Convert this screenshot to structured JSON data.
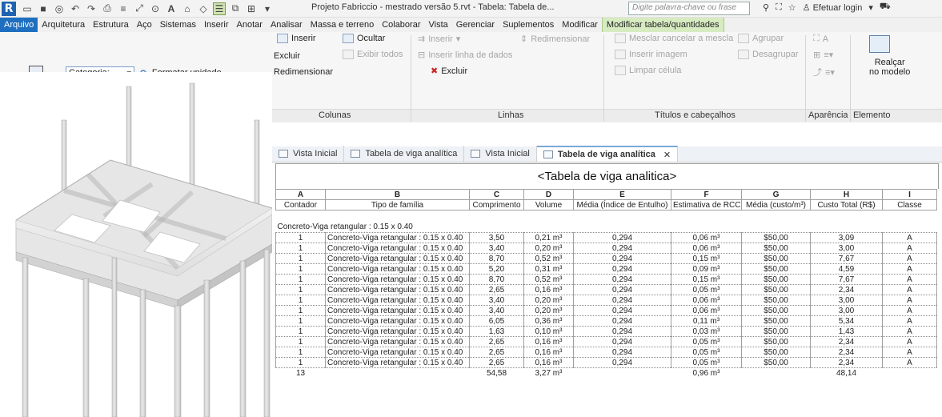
{
  "titlebar": {
    "title": "Projeto Fabriccio - mestrado versão 5.rvt - Tabela: Tabela de...",
    "search_placeholder": "Digite palavra-chave ou frase",
    "login": "Efetuar login"
  },
  "menu": [
    "Arquivo",
    "Arquitetura",
    "Estrutura",
    "Aço",
    "Sistemas",
    "Inserir",
    "Anotar",
    "Analisar",
    "Massa e terreno",
    "Colaborar",
    "Vista",
    "Gerenciar",
    "Suplementos",
    "Modificar",
    "Modificar tabela/quantidades"
  ],
  "props": {
    "category_label": "Categoria:",
    "format_unit": "Formatar unidade"
  },
  "ribbon": {
    "colunas": {
      "inserir": "Inserir",
      "excluir": "Excluir",
      "redimensionar": "Redimensionar",
      "ocultar": "Ocultar",
      "exibir_todos": "Exibir todos",
      "label": "Colunas"
    },
    "linhas": {
      "inserir": "Inserir",
      "inserir_linha": "Inserir linha de dados",
      "excluir": "Excluir",
      "redimensionar": "Redimensionar",
      "label": "Linhas"
    },
    "titulos": {
      "mesclar": "Mesclar cancelar a mescla",
      "agrupar": "Agrupar",
      "inserir_imagem": "Inserir imagem",
      "desagrupar": "Desagrupar",
      "limpar": "Limpar célula",
      "label": "Títulos e cabeçalhos"
    },
    "aparencia": {
      "label": "Aparência"
    },
    "elemento": {
      "realcar": "Realçar",
      "no_modelo": "no modelo",
      "label": "Elemento"
    }
  },
  "tabs": [
    {
      "label": "Vista Inicial",
      "active": false
    },
    {
      "label": "Tabela de viga analítica",
      "active": false
    },
    {
      "label": "Vista Inicial",
      "active": false
    },
    {
      "label": "Tabela de viga analítica",
      "active": true
    }
  ],
  "schedule": {
    "title": "<Tabela de viga analitica>",
    "letters": [
      "A",
      "B",
      "C",
      "D",
      "E",
      "F",
      "G",
      "H",
      "I"
    ],
    "headers": [
      "Contador",
      "Tipo de família",
      "Comprimento",
      "Volume",
      "Média (Índice de Entulho)",
      "Estimativa de RCC",
      "Média (custo/m³)",
      "Custo Total (R$)",
      "Classe"
    ],
    "group_label": "Concreto-Viga retangular : 0.15 x 0.40",
    "rows": [
      [
        "1",
        "Concreto-Viga retangular : 0.15 x 0.40",
        "3,50",
        "0,21 m³",
        "0,294",
        "0,06 m³",
        "$50,00",
        "3,09",
        "A"
      ],
      [
        "1",
        "Concreto-Viga retangular : 0.15 x 0.40",
        "3,40",
        "0,20 m³",
        "0,294",
        "0,06 m³",
        "$50,00",
        "3,00",
        "A"
      ],
      [
        "1",
        "Concreto-Viga retangular : 0.15 x 0.40",
        "8,70",
        "0,52 m³",
        "0,294",
        "0,15 m³",
        "$50,00",
        "7,67",
        "A"
      ],
      [
        "1",
        "Concreto-Viga retangular : 0.15 x 0.40",
        "5,20",
        "0,31 m³",
        "0,294",
        "0,09 m³",
        "$50,00",
        "4,59",
        "A"
      ],
      [
        "1",
        "Concreto-Viga retangular : 0.15 x 0.40",
        "8,70",
        "0,52 m³",
        "0,294",
        "0,15 m³",
        "$50,00",
        "7,67",
        "A"
      ],
      [
        "1",
        "Concreto-Viga retangular : 0.15 x 0.40",
        "2,65",
        "0,16 m³",
        "0,294",
        "0,05 m³",
        "$50,00",
        "2,34",
        "A"
      ],
      [
        "1",
        "Concreto-Viga retangular : 0.15 x 0.40",
        "3,40",
        "0,20 m³",
        "0,294",
        "0,06 m³",
        "$50,00",
        "3,00",
        "A"
      ],
      [
        "1",
        "Concreto-Viga retangular : 0.15 x 0.40",
        "3,40",
        "0,20 m³",
        "0,294",
        "0,06 m³",
        "$50,00",
        "3,00",
        "A"
      ],
      [
        "1",
        "Concreto-Viga retangular : 0.15 x 0.40",
        "6,05",
        "0,36 m³",
        "0,294",
        "0,11 m³",
        "$50,00",
        "5,34",
        "A"
      ],
      [
        "1",
        "Concreto-Viga retangular : 0.15 x 0.40",
        "1,63",
        "0,10 m³",
        "0,294",
        "0,03 m³",
        "$50,00",
        "1,43",
        "A"
      ],
      [
        "1",
        "Concreto-Viga retangular : 0.15 x 0.40",
        "2,65",
        "0,16 m³",
        "0,294",
        "0,05 m³",
        "$50,00",
        "2,34",
        "A"
      ],
      [
        "1",
        "Concreto-Viga retangular : 0.15 x 0.40",
        "2,65",
        "0,16 m³",
        "0,294",
        "0,05 m³",
        "$50,00",
        "2,34",
        "A"
      ],
      [
        "1",
        "Concreto-Viga retangular : 0.15 x 0.40",
        "2,65",
        "0,16 m³",
        "0,294",
        "0,05 m³",
        "$50,00",
        "2,34",
        "A"
      ]
    ],
    "totals": [
      "13",
      "",
      "54,58",
      "3,27 m³",
      "",
      "0,96 m³",
      "",
      "48,14",
      ""
    ]
  },
  "colors": {
    "accent": "#1e6fbf",
    "context_tab": "#d7ebc1"
  }
}
